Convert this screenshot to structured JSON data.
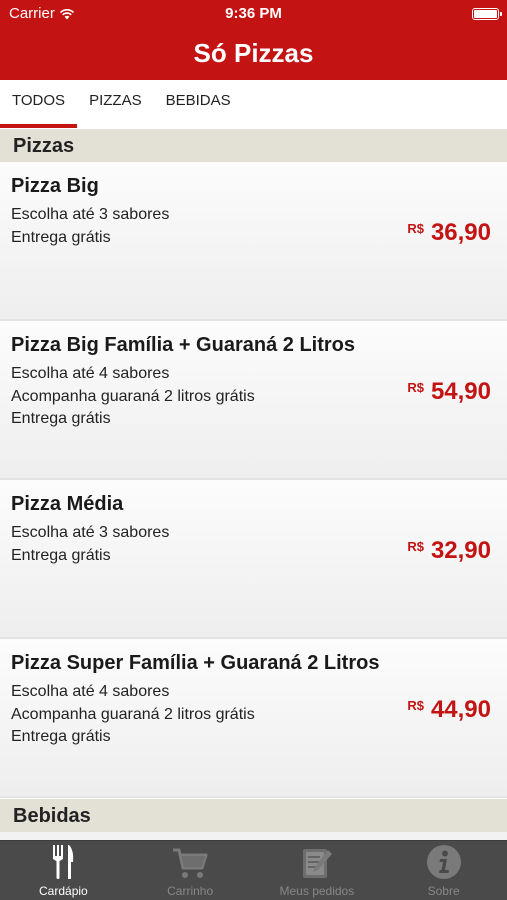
{
  "status_bar": {
    "carrier": "Carrier",
    "time": "9:36 PM"
  },
  "navbar": {
    "title": "Só Pizzas"
  },
  "tabs": [
    {
      "label": "TODOS",
      "active": true
    },
    {
      "label": "PIZZAS",
      "active": false
    },
    {
      "label": "BEBIDAS",
      "active": false
    }
  ],
  "sections": [
    {
      "title": "Pizzas",
      "items": [
        {
          "name": "Pizza Big",
          "lines": [
            "Escolha até 3 sabores",
            "Entrega grátis"
          ],
          "currency": "R$",
          "price": "36,90"
        },
        {
          "name": "Pizza Big Família + Guaraná 2 Litros",
          "lines": [
            "Escolha até 4 sabores",
            "Acompanha guaraná 2 litros grátis",
            "Entrega grátis"
          ],
          "currency": "R$",
          "price": "54,90"
        },
        {
          "name": "Pizza Média",
          "lines": [
            "Escolha até 3 sabores",
            "Entrega grátis"
          ],
          "currency": "R$",
          "price": "32,90"
        },
        {
          "name": "Pizza Super Família + Guaraná 2 Litros",
          "lines": [
            "Escolha até 4 sabores",
            "Acompanha guaraná 2 litros grátis",
            "Entrega grátis"
          ],
          "currency": "R$",
          "price": "44,90"
        }
      ]
    },
    {
      "title": "Bebidas",
      "items": []
    }
  ],
  "tab_bar": [
    {
      "label": "Cardápio",
      "icon": "fork-knife-icon",
      "active": true
    },
    {
      "label": "Carrinho",
      "icon": "cart-icon",
      "active": false
    },
    {
      "label": "Meus pedidos",
      "icon": "orders-icon",
      "active": false
    },
    {
      "label": "Sobre",
      "icon": "info-icon",
      "active": false
    }
  ],
  "colors": {
    "brand_red": "#c41313",
    "section_bg": "#e3e1d6",
    "tabbar_bg": "#4a4a4a"
  }
}
